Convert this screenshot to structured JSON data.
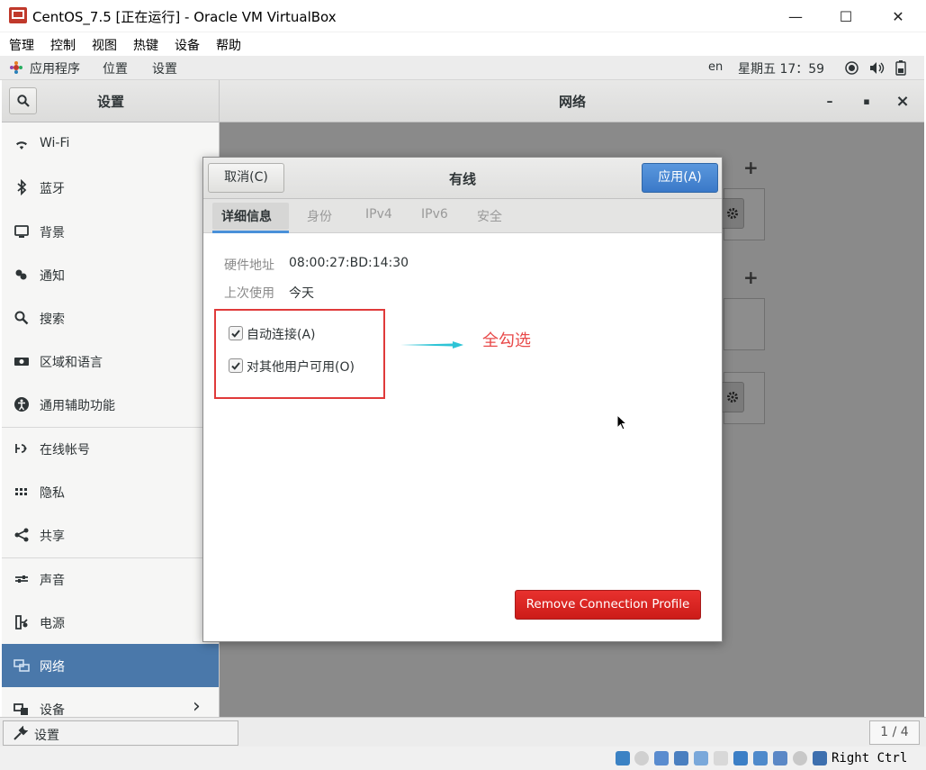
{
  "window": {
    "title": "CentOS_7.5 [正在运行] - Oracle VM VirtualBox",
    "minimize_glyph": "—",
    "maximize_glyph": "☐",
    "close_glyph": "✕"
  },
  "menubar": [
    "管理",
    "控制",
    "视图",
    "热键",
    "设备",
    "帮助"
  ],
  "gnome_topbar": {
    "applications": "应用程序",
    "places": "位置",
    "settings": "设置",
    "lang": "en",
    "clock": "星期五 17：59"
  },
  "headerbar": {
    "left_title": "设置",
    "right_title": "网络",
    "min_glyph": "–",
    "max_glyph": "▪",
    "close_glyph": "×"
  },
  "sidebar": {
    "items": [
      {
        "label": "Wi-Fi",
        "icon": "wifi-icon"
      },
      {
        "label": "蓝牙",
        "icon": "bluetooth-icon"
      },
      {
        "label": "背景",
        "icon": "background-icon"
      },
      {
        "label": "通知",
        "icon": "notifications-icon"
      },
      {
        "label": "搜索",
        "icon": "search-icon"
      },
      {
        "label": "区域和语言",
        "icon": "region-icon"
      },
      {
        "label": "通用辅助功能",
        "icon": "accessibility-icon"
      },
      {
        "label": "在线帐号",
        "icon": "online-accounts-icon"
      },
      {
        "label": "隐私",
        "icon": "privacy-icon"
      },
      {
        "label": "共享",
        "icon": "share-icon"
      },
      {
        "label": "声音",
        "icon": "sound-icon"
      },
      {
        "label": "电源",
        "icon": "power-icon"
      },
      {
        "label": "网络",
        "icon": "network-icon",
        "active": true
      },
      {
        "label": "设备",
        "icon": "devices-icon",
        "chevron": "›"
      }
    ]
  },
  "main": {
    "add_glyph": "+"
  },
  "dialog": {
    "title": "有线",
    "cancel_label": "取消(C)",
    "apply_label": "应用(A)",
    "tabs": [
      "详细信息",
      "身份",
      "IPv4",
      "IPv6",
      "安全"
    ],
    "active_tab": 0,
    "hardware_address_label": "硬件地址",
    "hardware_address_value": "08:00:27:BD:14:30",
    "last_used_label": "上次使用",
    "last_used_value": "今天",
    "auto_connect_label": "自动连接(A)",
    "auto_connect_checked": true,
    "all_users_label": "对其他用户可用(O)",
    "all_users_checked": true,
    "remove_label": "Remove Connection Profile"
  },
  "annotation": {
    "text": "全勾选",
    "color": "#e84a4a"
  },
  "bottom": {
    "task_label": "设置",
    "workspace": "1 / 4"
  },
  "vbox_status": {
    "host_key": "Right Ctrl"
  },
  "colors": {
    "sidebar_active": "#4a78aa",
    "apply_button": "#3a79c8",
    "remove_button": "#cc1b18",
    "annotation_arrow": "#2ec4d6"
  }
}
